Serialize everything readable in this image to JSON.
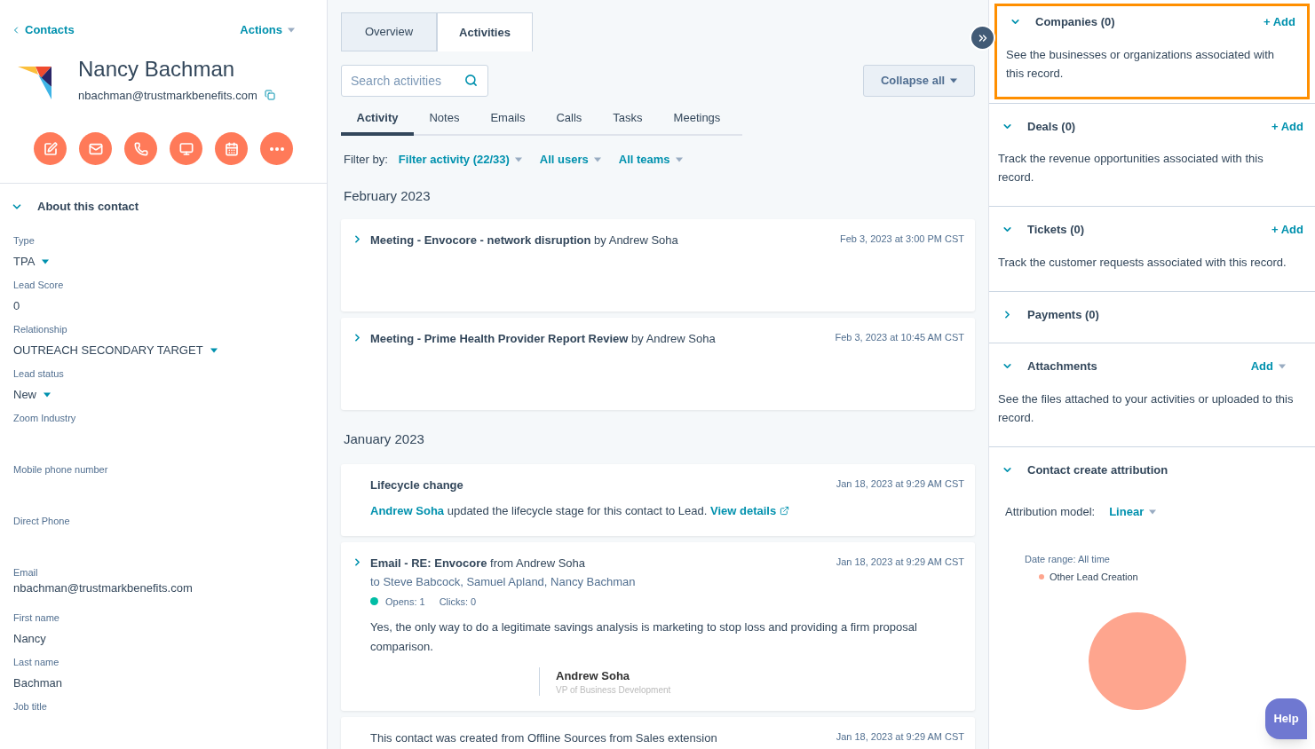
{
  "left": {
    "back_link": "Contacts",
    "actions": "Actions",
    "name": "Nancy Bachman",
    "email": "nbachman@trustmarkbenefits.com",
    "about_title": "About this contact",
    "about_expanded": true,
    "fields": [
      {
        "label": "Type",
        "value": "TPA",
        "kind": "dropdown"
      },
      {
        "label": "Lead Score",
        "value": "0",
        "kind": "text"
      },
      {
        "label": "Relationship",
        "value": "OUTREACH SECONDARY TARGET",
        "kind": "dropdown"
      },
      {
        "label": "Lead status",
        "value": "New",
        "kind": "dropdown"
      },
      {
        "label": "Zoom Industry",
        "kind": "empty"
      },
      {
        "label": "Mobile phone number",
        "kind": "empty"
      },
      {
        "label": "Direct Phone",
        "kind": "empty"
      },
      {
        "label": "Email",
        "value": "nbachman@trustmarkbenefits.com",
        "kind": "tight"
      },
      {
        "label": "First name",
        "value": "Nancy",
        "kind": "text"
      },
      {
        "label": "Last name",
        "value": "Bachman",
        "kind": "text"
      },
      {
        "label": "Job title",
        "kind": "empty"
      }
    ]
  },
  "main": {
    "tabs": [
      {
        "label": "Overview",
        "selected": false
      },
      {
        "label": "Activities",
        "selected": true
      }
    ],
    "search": {
      "placeholder": "Search activities"
    },
    "collapse_button": "Collapse all",
    "subtabs": [
      {
        "label": "Activity",
        "selected": true
      },
      {
        "label": "Notes",
        "selected": false
      },
      {
        "label": "Emails",
        "selected": false
      },
      {
        "label": "Calls",
        "selected": false
      },
      {
        "label": "Tasks",
        "selected": false
      },
      {
        "label": "Meetings",
        "selected": false
      }
    ],
    "filter_label": "Filter by:",
    "filters": [
      "Filter activity (22/33)",
      "All users",
      "All teams"
    ],
    "groups": [
      {
        "month": "February 2023",
        "items": [
          {
            "kind": "meeting",
            "title": "**Meeting - Envocore - network disruption** by Andrew Soha",
            "time": "Feb 3, 2023 at 3:00 PM CST"
          },
          {
            "kind": "meeting",
            "title": "**Meeting - Prime Health Provider Report Review** by Andrew Soha",
            "time": "Feb 3, 2023 at 10:45 AM CST"
          }
        ]
      },
      {
        "month": "January 2023",
        "items": [
          {
            "kind": "lifecycle",
            "title": "Lifecycle change",
            "time": "Jan 18, 2023 at 9:29 AM CST",
            "actor": "Andrew Soha",
            "text": "updated the lifecycle stage for this contact to Lead.",
            "link": "View details"
          },
          {
            "kind": "email",
            "title": "**Email - RE: Envocore** from Andrew Soha",
            "time": "Jan 18, 2023 at 9:29 AM CST",
            "recipients": "to Steve Babcock, Samuel Apland, Nancy Bachman",
            "opens": "Opens: 1",
            "clicks": "Clicks: 0",
            "body": "Yes, the only way to do a legitimate savings analysis is marketing to stop loss and providing a firm proposal comparison.",
            "sig_name": "Andrew Soha",
            "sig_title": "VP of Business Development"
          },
          {
            "kind": "created",
            "title": "This contact was created from Offline Sources from Sales extension",
            "time": "Jan 18, 2023 at 9:29 AM CST"
          }
        ]
      }
    ]
  },
  "right": {
    "sections": [
      {
        "title": "Companies (0)",
        "expanded": true,
        "highlighted": true,
        "action": "+ Add",
        "action_menu": false,
        "description": "See the businesses or organizations associated with this record."
      },
      {
        "title": "Deals (0)",
        "expanded": true,
        "action": "+ Add",
        "action_menu": false,
        "description": "Track the revenue opportunities associated with this record."
      },
      {
        "title": "Tickets (0)",
        "expanded": true,
        "action": "+ Add",
        "action_menu": false,
        "description": "Track the customer requests associated with this record."
      },
      {
        "title": "Payments (0)",
        "expanded": false
      },
      {
        "title": "Attachments",
        "expanded": true,
        "action": "Add",
        "action_menu": true,
        "description": "See the files attached to your activities or uploaded to this record."
      }
    ],
    "attribution": {
      "title": "Contact create attribution",
      "expanded": true,
      "model_label": "Attribution model:",
      "model": "Linear",
      "date_range": "Date range: All time",
      "legend": [
        {
          "label": "Other Lead Creation",
          "color": "#fea58e"
        }
      ]
    },
    "help": "Help"
  }
}
